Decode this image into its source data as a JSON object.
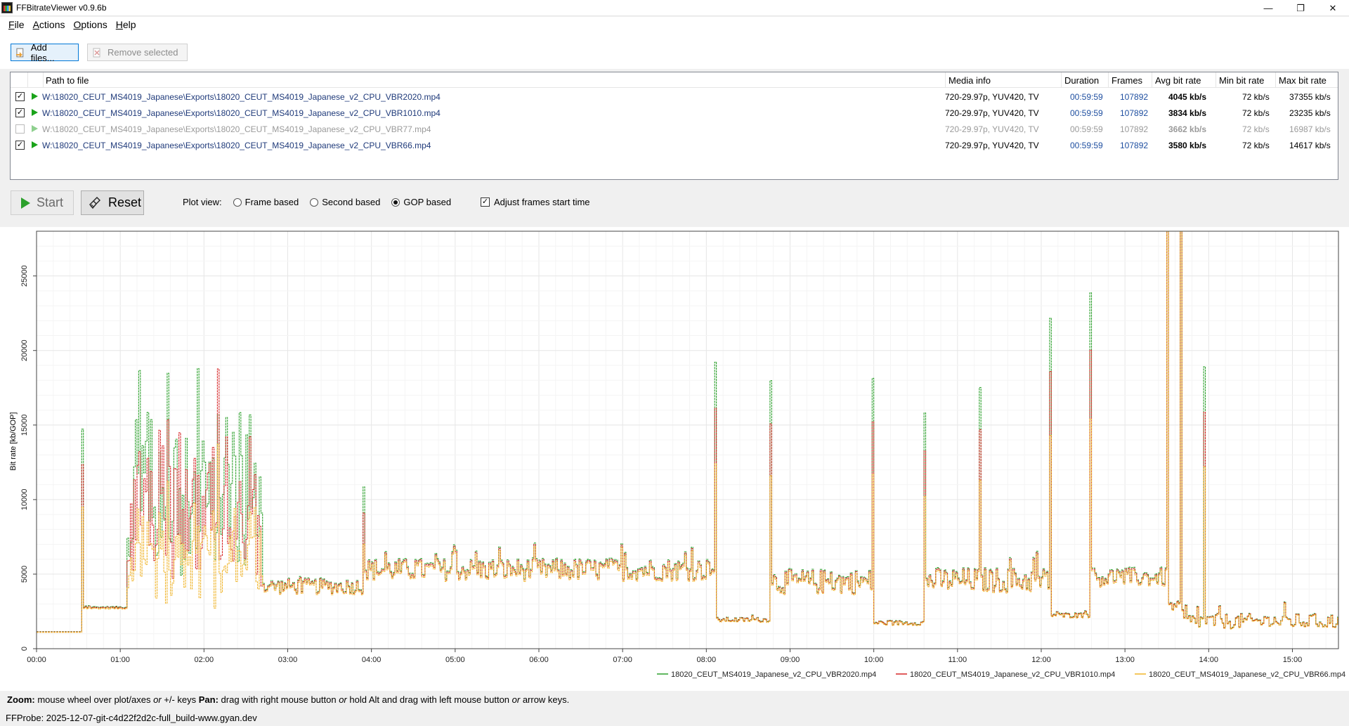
{
  "window": {
    "title": "FFBitrateViewer v0.9.6b"
  },
  "menu": [
    {
      "label": "File",
      "key": "F",
      "rest": "ile"
    },
    {
      "label": "Actions",
      "key": "A",
      "rest": "ctions"
    },
    {
      "label": "Options",
      "key": "O",
      "rest": "ptions"
    },
    {
      "label": "Help",
      "key": "H",
      "rest": "elp"
    }
  ],
  "toolbar": {
    "add_files": "Add files...",
    "remove_selected": "Remove selected"
  },
  "columns": [
    "Path to file",
    "Media info",
    "Duration",
    "Frames",
    "Avg bit rate",
    "Min bit rate",
    "Max bit rate"
  ],
  "files": [
    {
      "checked": true,
      "path": "W:\\18020_CEUT_MS4019_Japanese\\Exports\\18020_CEUT_MS4019_Japanese_v2_CPU_VBR2020.mp4",
      "media": "720-29.97p, YUV420, TV",
      "duration": "00:59:59",
      "frames": "107892",
      "avg": "4045 kb/s",
      "min": "72 kb/s",
      "max": "37355 kb/s"
    },
    {
      "checked": true,
      "path": "W:\\18020_CEUT_MS4019_Japanese\\Exports\\18020_CEUT_MS4019_Japanese_v2_CPU_VBR1010.mp4",
      "media": "720-29.97p, YUV420, TV",
      "duration": "00:59:59",
      "frames": "107892",
      "avg": "3834 kb/s",
      "min": "72 kb/s",
      "max": "23235 kb/s"
    },
    {
      "checked": false,
      "path": "W:\\18020_CEUT_MS4019_Japanese\\Exports\\18020_CEUT_MS4019_Japanese_v2_CPU_VBR77.mp4",
      "media": "720-29.97p, YUV420, TV",
      "duration": "00:59:59",
      "frames": "107892",
      "avg": "3662 kb/s",
      "min": "72 kb/s",
      "max": "16987 kb/s"
    },
    {
      "checked": true,
      "path": "W:\\18020_CEUT_MS4019_Japanese\\Exports\\18020_CEUT_MS4019_Japanese_v2_CPU_VBR66.mp4",
      "media": "720-29.97p, YUV420, TV",
      "duration": "00:59:59",
      "frames": "107892",
      "avg": "3580 kb/s",
      "min": "72 kb/s",
      "max": "14617 kb/s"
    }
  ],
  "controls": {
    "start": "Start",
    "reset": "Reset",
    "plot_view_label": "Plot view:",
    "plot_view_options": [
      "Frame based",
      "Second based",
      "GOP based"
    ],
    "plot_view_selected": "GOP based",
    "adjust_label": "Adjust frames start time",
    "adjust_checked": true
  },
  "colors": {
    "green": "#2ca02c",
    "red": "#d62728",
    "yellow": "#f0b429",
    "grid": "#e3e3e3",
    "axis": "#555555"
  },
  "chart_data": {
    "type": "line",
    "ylabel": "Bit rate [kb/GOP]",
    "xlabel": "",
    "xlim_minutes": [
      0,
      15.55
    ],
    "ylim": [
      0,
      28000
    ],
    "x_ticks": [
      "00:00",
      "01:00",
      "02:00",
      "03:00",
      "04:00",
      "05:00",
      "06:00",
      "07:00",
      "08:00",
      "09:00",
      "10:00",
      "11:00",
      "12:00",
      "13:00",
      "14:00",
      "15:00"
    ],
    "y_ticks": [
      0,
      5000,
      10000,
      15000,
      20000,
      25000
    ],
    "legend_position": "bottom-right",
    "series": [
      {
        "name": "18020_CEUT_MS4019_Japanese_v2_CPU_VBR2020.mp4",
        "color": "#2ca02c",
        "scale": 1.6,
        "spike_scale": 1.55
      },
      {
        "name": "18020_CEUT_MS4019_Japanese_v2_CPU_VBR1010.mp4",
        "color": "#d62728",
        "scale": 1.35,
        "spike_scale": 1.3
      },
      {
        "name": "18020_CEUT_MS4019_Japanese_v2_CPU_VBR66.mp4",
        "color": "#f0b429",
        "scale": 1.0,
        "spike_scale": 1.0
      }
    ],
    "base_segments": [
      {
        "t0": 0.0,
        "t1": 0.55,
        "level": 1100,
        "var": 0
      },
      {
        "t0": 0.55,
        "t1": 1.08,
        "level": 2700,
        "var": 50
      },
      {
        "t0": 1.08,
        "t1": 2.7,
        "level": 5200,
        "var": 2000
      },
      {
        "t0": 2.7,
        "t1": 3.9,
        "level": 4100,
        "var": 500
      },
      {
        "t0": 3.9,
        "t1": 8.1,
        "level": 5200,
        "var": 700
      },
      {
        "t0": 8.1,
        "t1": 8.75,
        "level": 1900,
        "var": 150
      },
      {
        "t0": 8.75,
        "t1": 9.98,
        "level": 4400,
        "var": 800
      },
      {
        "t0": 9.98,
        "t1": 10.6,
        "level": 1700,
        "var": 150
      },
      {
        "t0": 10.6,
        "t1": 12.1,
        "level": 4500,
        "var": 800
      },
      {
        "t0": 12.1,
        "t1": 12.57,
        "level": 2200,
        "var": 150
      },
      {
        "t0": 12.57,
        "t1": 13.5,
        "level": 4700,
        "var": 600
      },
      {
        "t0": 13.5,
        "t1": 13.65,
        "level": 2800,
        "var": 300
      },
      {
        "t0": 13.65,
        "t1": 15.55,
        "level": 1800,
        "var": 500
      }
    ],
    "spikes": [
      {
        "t": 0.55,
        "v": 9500
      },
      {
        "t": 3.9,
        "v": 7000
      },
      {
        "t": 8.1,
        "v": 12400
      },
      {
        "t": 8.75,
        "v": 11600
      },
      {
        "t": 9.98,
        "v": 11700
      },
      {
        "t": 10.6,
        "v": 10200
      },
      {
        "t": 11.25,
        "v": 11300
      },
      {
        "t": 12.1,
        "v": 14300
      },
      {
        "t": 12.57,
        "v": 15400
      },
      {
        "t": 13.5,
        "v": 28000
      },
      {
        "t": 13.65,
        "v": 28000
      },
      {
        "t": 13.93,
        "v": 12200
      }
    ]
  },
  "hints": {
    "zoom_label": "Zoom:",
    "zoom_text": " mouse wheel over plot/axes ",
    "or1": "or",
    "zoom_keys": " +/- keys  ",
    "pan_label": "Pan:",
    "pan_text": " drag with right mouse button ",
    "or2": "or",
    "pan_text2": " hold Alt and drag with left mouse button ",
    "or3": "or",
    "pan_text3": " arrow keys."
  },
  "status": "FFProbe: 2025-12-07-git-c4d22f2d2c-full_build-www.gyan.dev"
}
